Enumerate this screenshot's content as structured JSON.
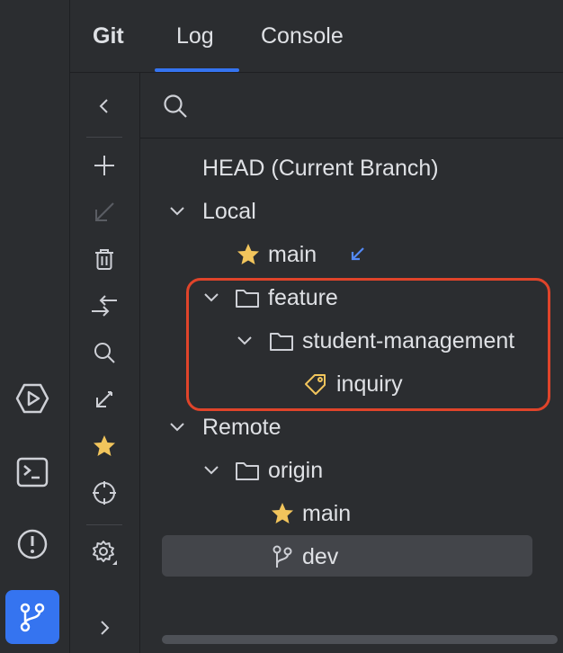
{
  "tabs": {
    "git": "Git",
    "log": "Log",
    "console": "Console"
  },
  "search": {
    "placeholder": "",
    "value": ""
  },
  "tree": {
    "head": "HEAD (Current Branch)",
    "local": {
      "label": "Local",
      "main": "main",
      "feature": {
        "label": "feature",
        "student_management": {
          "label": "student-management",
          "inquiry": "inquiry"
        }
      }
    },
    "remote": {
      "label": "Remote",
      "origin": {
        "label": "origin",
        "main": "main",
        "dev": "dev"
      }
    }
  },
  "colors": {
    "accent": "#3574f0",
    "star": "#f2c55c",
    "highlight_border": "#e0442a",
    "selected_row": "#43454a",
    "incoming_arrow": "#548af7"
  },
  "icons": {
    "left_bar": [
      "run-icon",
      "terminal-icon",
      "problems-icon",
      "git-branch-icon"
    ],
    "toolbar": [
      "collapse-icon",
      "add-icon",
      "checkout-icon",
      "delete-icon",
      "compare-icon",
      "search-icon",
      "update-icon",
      "favorite-icon",
      "locate-icon",
      "settings-icon",
      "expand-icon"
    ]
  }
}
